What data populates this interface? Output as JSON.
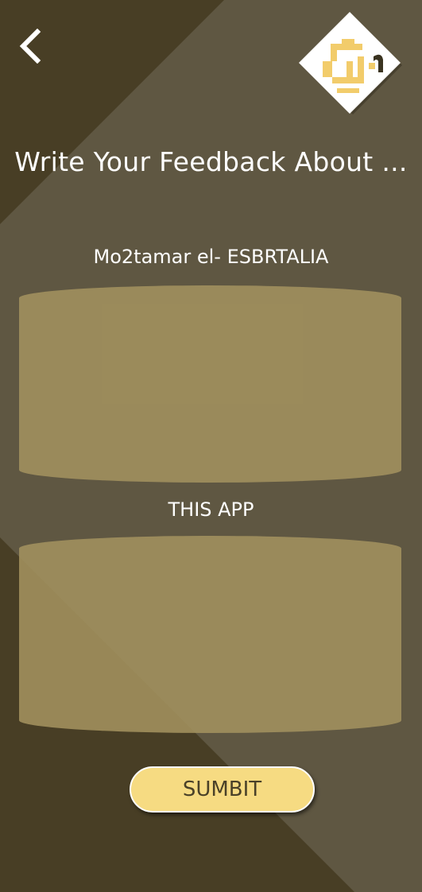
{
  "header": {
    "back_icon": "chevron-left-icon",
    "logo_icon": "app-logo-diamond"
  },
  "page": {
    "title": "Write Your Feedback About ..."
  },
  "form": {
    "field1_label": "Mo2tamar el- ESBRTALIA",
    "field1_value": "",
    "field2_label": "THIS APP",
    "field2_value": "",
    "submit_label": "SUMBIT"
  },
  "colors": {
    "background": "#5f5742",
    "dark_band": "#483e25",
    "input_fill": "#988a5d",
    "button_fill": "#f6db82",
    "button_text": "#4a4128",
    "text": "#ffffff"
  }
}
